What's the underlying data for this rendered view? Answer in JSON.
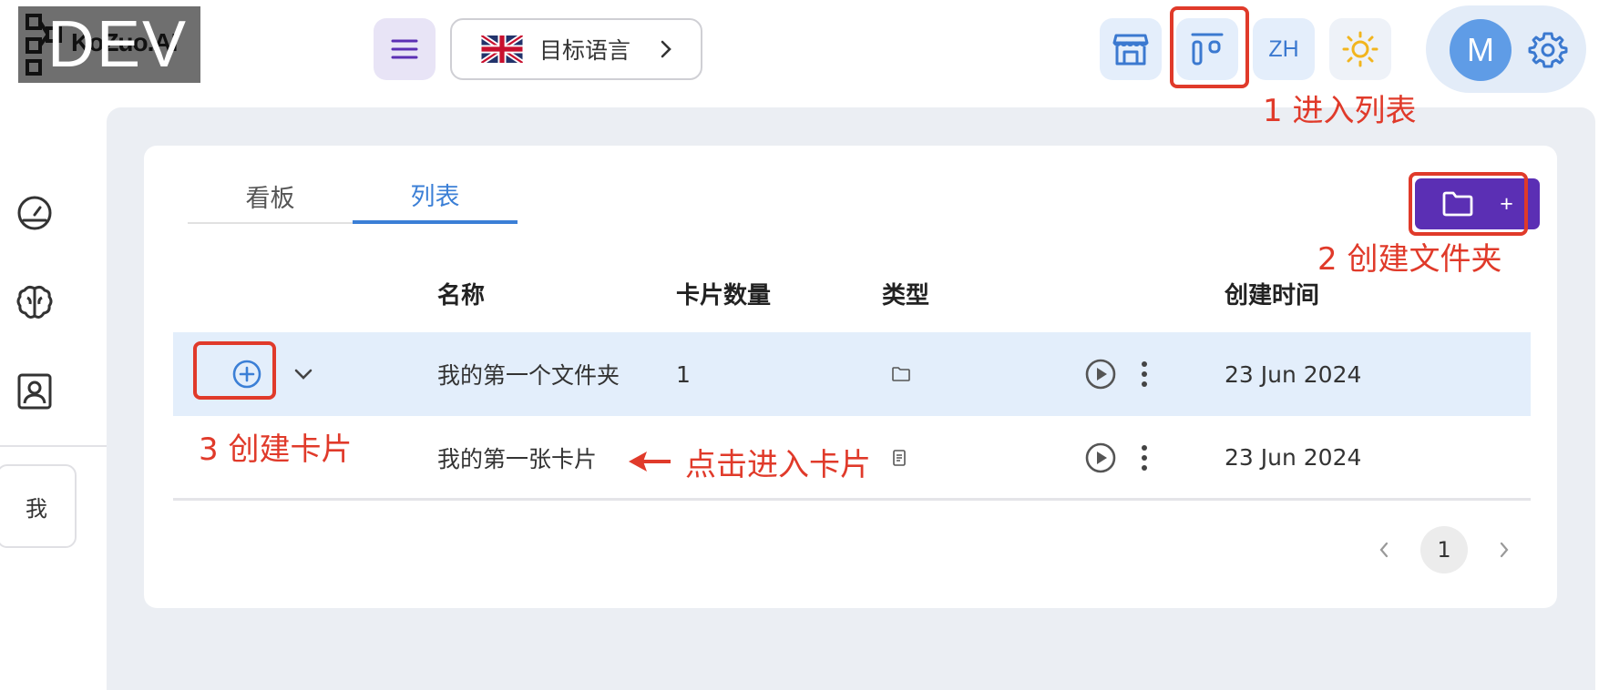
{
  "header": {
    "logo_text_small": "KoZuo.AI",
    "logo_text_big": "DEV",
    "language_button_label": "目标语言",
    "lang_code_label": "ZH",
    "avatar_letter": "M"
  },
  "sidebar": {
    "me_label": "我"
  },
  "tabs": [
    {
      "label": "看板",
      "active": false
    },
    {
      "label": "列表",
      "active": true
    }
  ],
  "add_folder_button": {
    "plus": "+"
  },
  "table": {
    "columns": [
      "名称",
      "卡片数量",
      "类型",
      "创建时间"
    ],
    "rows": [
      {
        "name": "我的第一个文件夹",
        "count": "1",
        "type": "folder",
        "created": "23 Jun 2024",
        "expanded": true
      },
      {
        "name": "我的第一张卡片",
        "count": "",
        "type": "card",
        "created": "23 Jun 2024"
      }
    ]
  },
  "pagination": {
    "current": "1"
  },
  "annotations": {
    "step1": "1 进入列表",
    "step2": "2 创建文件夹",
    "step3": "3 创建卡片",
    "click_card": "点击进入卡片"
  },
  "colors": {
    "accent_blue": "#3b7fd6",
    "primary_purple": "#5b2fb4",
    "annotation_red": "#e03a2a",
    "row_highlight": "#e3eefb"
  }
}
